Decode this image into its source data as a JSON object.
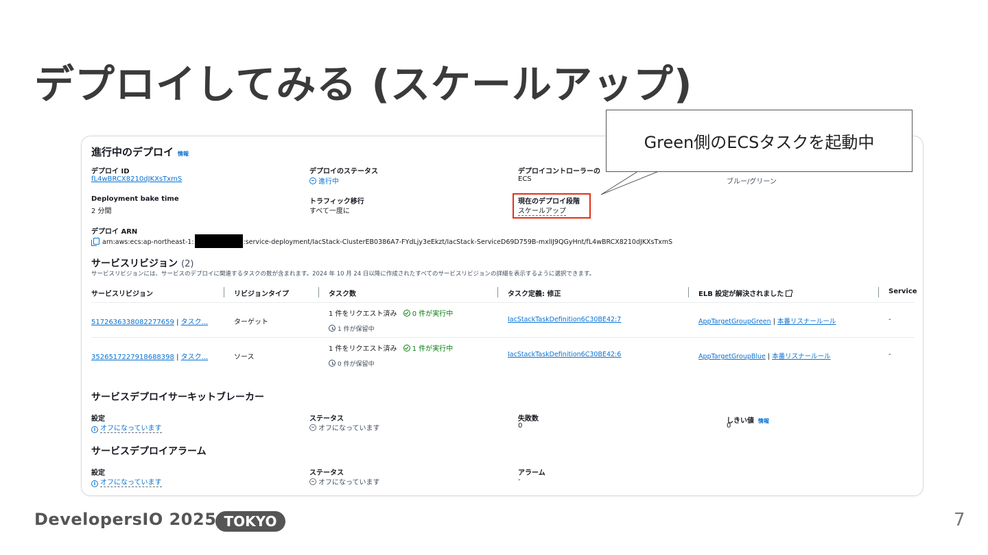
{
  "slide": {
    "title": "デプロイしてみる (スケールアップ)",
    "page_number": "7",
    "brand": "DevelopersIO 2025",
    "brand_badge": "TOKYO"
  },
  "callout": {
    "text": "Green側のECSタスクを起動中"
  },
  "deploy": {
    "heading": "進行中のデプロイ",
    "info": "情報",
    "id_label": "デプロイ ID",
    "id_value": "fL4wBRCX8210dJKXsTxmS",
    "status_label": "デプロイのステータス",
    "status_value": "進行中",
    "controller_label": "デプロイコントローラーの",
    "controller_value": "ECS",
    "strategy_value": "ブルー/グリーン",
    "bake_label": "Deployment bake time",
    "bake_value": "2 分間",
    "traffic_label": "トラフィック移行",
    "traffic_value": "すべて一度に",
    "stage_label": "現在のデプロイ段階",
    "stage_value": "スケールアップ",
    "arn_label": "デプロイ ARN",
    "arn_prefix": "arn:aws:ecs:ap-northeast-1:",
    "arn_suffix": ":service-deployment/IacStack-ClusterEB0386A7-FYdLjy3eEkzt/IacStack-ServiceD69D759B-mxlIJ9QGyHnt/fL4wBRCX8210dJKXsTxmS"
  },
  "revisions": {
    "heading": "サービスリビジョン",
    "count": "(2)",
    "description": "サービスリビジョンには、サービスのデプロイに関連するタスクの数が含まれます。2024 年 10 月 24 日以降に作成されたすべてのサービスリビジョンの詳細を表示するように選択できます。",
    "columns": [
      "サービスリビジョン",
      "リビジョンタイプ",
      "タスク数",
      "タスク定義: 修正",
      "ELB 設定が解決されました",
      "Service"
    ],
    "rows": [
      {
        "revision_id": "5172636338082277659",
        "revision_link2": "タスク...",
        "type": "ターゲット",
        "requested": "1 件をリクエスト済み",
        "running": "0 件が実行中",
        "pending": "1 件が保留中",
        "task_def": "IacStackTaskDefinition6C30BE42:7",
        "target_group": "AppTargetGroupGreen",
        "listener_rule": "本番リスナールール",
        "service": "-"
      },
      {
        "revision_id": "3526517227918688398",
        "revision_link2": "タスク...",
        "type": "ソース",
        "requested": "1 件をリクエスト済み",
        "running": "1 件が実行中",
        "pending": "0 件が保留中",
        "task_def": "IacStackTaskDefinition6C30BE42:6",
        "target_group": "AppTargetGroupBlue",
        "listener_rule": "本番リスナールール",
        "service": "-"
      }
    ]
  },
  "breaker": {
    "heading": "サービスデプロイサーキットブレーカー",
    "setting_label": "設定",
    "setting_value": "オフになっています",
    "status_label": "ステータス",
    "status_value": "オフになっています",
    "failures_label": "失敗数",
    "failures_value": "0",
    "threshold_label": "しきい値",
    "threshold_info": "情報",
    "threshold_value": "0"
  },
  "alarm": {
    "heading": "サービスデプロイアラーム",
    "setting_label": "設定",
    "setting_value": "オフになっています",
    "status_label": "ステータス",
    "status_value": "オフになっています",
    "alarm_label": "アラーム",
    "alarm_value": "-"
  },
  "colors": {
    "link": "#0972d3",
    "highlight": "#e0321b",
    "success": "#037f0c"
  }
}
